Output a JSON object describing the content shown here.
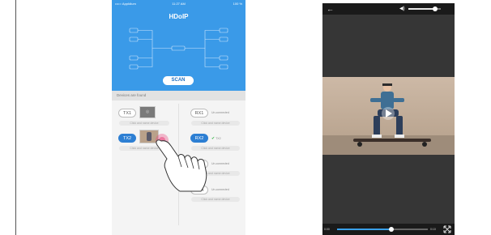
{
  "status_bar": {
    "carrier": "••••○ AppIdium",
    "time": "11:27 AM",
    "battery": "100 %"
  },
  "app": {
    "brand": "HDoIP",
    "scan_label": "SCAN",
    "devices_found_label": "Devices are found",
    "transmitters": [
      {
        "label": "TX1",
        "selected": false
      },
      {
        "label": "TX2",
        "selected": true
      }
    ],
    "receivers": [
      {
        "label": "RX1",
        "selected": false,
        "status": "Un-connected"
      },
      {
        "label": "RX2",
        "selected": true,
        "status": "TX2"
      },
      {
        "label": "RX3",
        "selected": false,
        "status": "Un-connected"
      },
      {
        "label": "RX4",
        "selected": false,
        "status": "Un-connected"
      }
    ],
    "sub_label": "Click and name device"
  },
  "player": {
    "elapsed": "0:00",
    "remaining": "0:10",
    "progress": 0.6,
    "volume": 0.82,
    "colors": {
      "accent": "#39a0e9"
    }
  },
  "icons": [
    "back-arrow-icon",
    "volume-icon",
    "play-icon",
    "fullscreen-icon",
    "hand-pointer-icon"
  ]
}
